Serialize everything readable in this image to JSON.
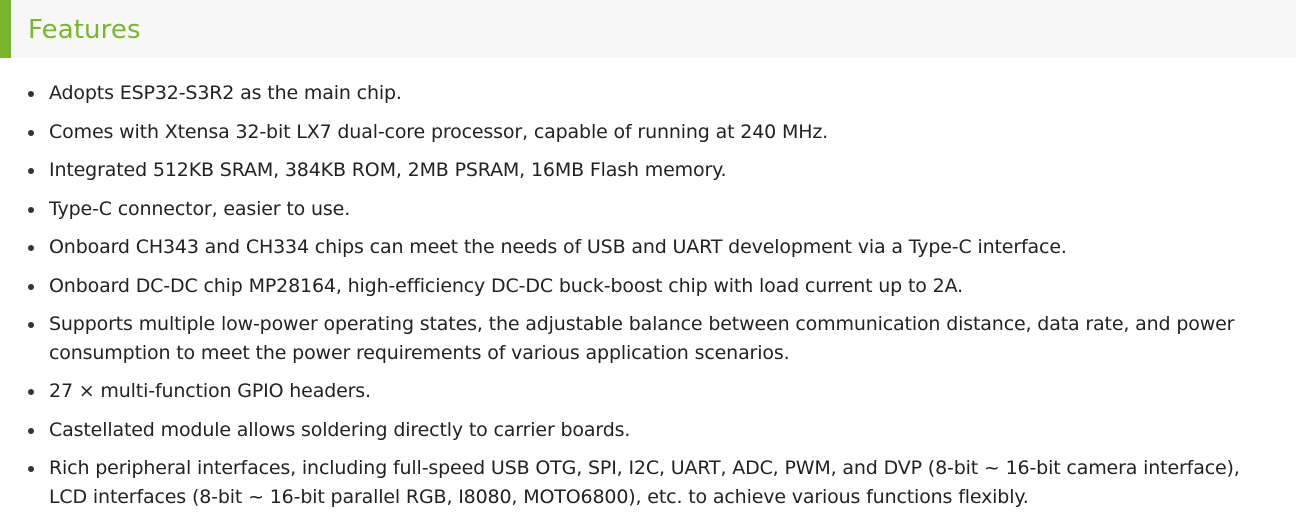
{
  "section": {
    "title": "Features"
  },
  "features": [
    "Adopts ESP32-S3R2 as the main chip.",
    "Comes with Xtensa 32-bit LX7 dual-core processor, capable of running at 240 MHz.",
    "Integrated 512KB SRAM, 384KB ROM, 2MB PSRAM, 16MB Flash memory.",
    "Type-C connector, easier to use.",
    "Onboard CH343 and CH334 chips can meet the needs of USB and UART development via a Type-C interface.",
    "Onboard DC-DC chip MP28164, high-efficiency DC-DC buck-boost chip with load current up to 2A.",
    "Supports multiple low-power operating states, the adjustable balance between communication distance, data rate, and power consumption to meet the power requirements of various application scenarios.",
    "27 × multi-function GPIO headers.",
    "Castellated module allows soldering directly to carrier boards.",
    "Rich peripheral interfaces, including full-speed USB OTG, SPI, I2C, UART, ADC, PWM, and DVP (8-bit ~ 16-bit camera interface), LCD interfaces (8-bit ~ 16-bit parallel RGB, I8080, MOTO6800), etc. to achieve various functions flexibly."
  ]
}
